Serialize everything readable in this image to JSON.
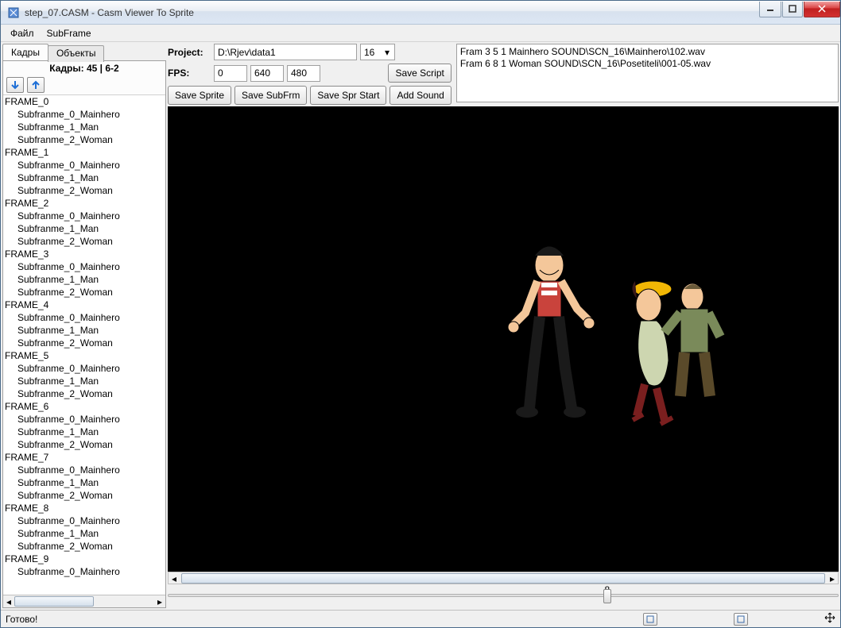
{
  "window": {
    "title": "step_07.CASM - Casm Viewer To Sprite"
  },
  "menu": {
    "file": "Файл",
    "subframe": "SubFrame"
  },
  "tabs": {
    "frames": "Кадры",
    "objects": "Объекты"
  },
  "frames_header": "Кадры: 45 | 6-2",
  "tree": [
    {
      "f": "FRAME_0",
      "s": [
        "Subfranme_0_Mainhero",
        "Subfranme_1_Man",
        "Subfranme_2_Woman"
      ]
    },
    {
      "f": "FRAME_1",
      "s": [
        "Subfranme_0_Mainhero",
        "Subfranme_1_Man",
        "Subfranme_2_Woman"
      ]
    },
    {
      "f": "FRAME_2",
      "s": [
        "Subfranme_0_Mainhero",
        "Subfranme_1_Man",
        "Subfranme_2_Woman"
      ]
    },
    {
      "f": "FRAME_3",
      "s": [
        "Subfranme_0_Mainhero",
        "Subfranme_1_Man",
        "Subfranme_2_Woman"
      ]
    },
    {
      "f": "FRAME_4",
      "s": [
        "Subfranme_0_Mainhero",
        "Subfranme_1_Man",
        "Subfranme_2_Woman"
      ]
    },
    {
      "f": "FRAME_5",
      "s": [
        "Subfranme_0_Mainhero",
        "Subfranme_1_Man",
        "Subfranme_2_Woman"
      ]
    },
    {
      "f": "FRAME_6",
      "s": [
        "Subfranme_0_Mainhero",
        "Subfranme_1_Man",
        "Subfranme_2_Woman"
      ]
    },
    {
      "f": "FRAME_7",
      "s": [
        "Subfranme_0_Mainhero",
        "Subfranme_1_Man",
        "Subfranme_2_Woman"
      ]
    },
    {
      "f": "FRAME_8",
      "s": [
        "Subfranme_0_Mainhero",
        "Subfranme_1_Man",
        "Subfranme_2_Woman"
      ]
    },
    {
      "f": "FRAME_9",
      "s": [
        "Subfranme_0_Mainhero"
      ]
    }
  ],
  "controls": {
    "project_label": "Project:",
    "project_path": "D:\\Rjev\\data1",
    "scene_num": "16",
    "fps_label": "FPS:",
    "fps": "0",
    "width": "640",
    "height": "480",
    "save_script": "Save Script",
    "save_sprite": "Save Sprite",
    "save_subfrm": "Save SubFrm",
    "save_spr_start": "Save Spr Start",
    "add_sound": "Add Sound"
  },
  "log": "Fram 3 5 1 Mainhero SOUND\\SCN_16\\Mainhero\\102.wav\nFram 6 8 1 Woman SOUND\\SCN_16\\Posetiteli\\001-05.wav",
  "slider": {
    "value": "8"
  },
  "status": {
    "text": "Готово!"
  }
}
